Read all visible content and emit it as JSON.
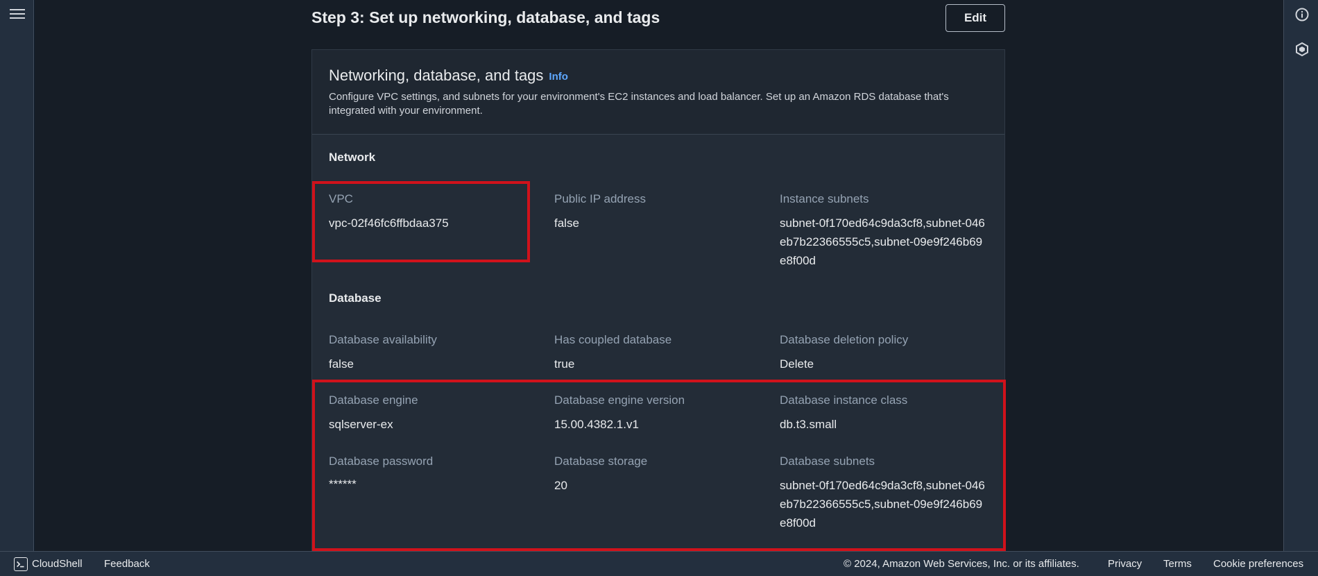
{
  "step": {
    "title": "Step 3: Set up networking, database, and tags",
    "edit_label": "Edit"
  },
  "panel": {
    "title": "Networking, database, and tags",
    "info_label": "Info",
    "description": "Configure VPC settings, and subnets for your environment's EC2 instances and load balancer. Set up an Amazon RDS database that's integrated with your environment."
  },
  "network": {
    "heading": "Network",
    "vpc_label": "VPC",
    "vpc_value": "vpc-02f46fc6ffbdaa375",
    "public_ip_label": "Public IP address",
    "public_ip_value": "false",
    "instance_subnets_label": "Instance subnets",
    "instance_subnets_value": "subnet-0f170ed64c9da3cf8,subnet-046eb7b22366555c5,subnet-09e9f246b69e8f00d"
  },
  "database": {
    "heading": "Database",
    "availability_label": "Database availability",
    "availability_value": "false",
    "coupled_label": "Has coupled database",
    "coupled_value": "true",
    "deletion_label": "Database deletion policy",
    "deletion_value": "Delete",
    "engine_label": "Database engine",
    "engine_value": "sqlserver-ex",
    "engine_version_label": "Database engine version",
    "engine_version_value": "15.00.4382.1.v1",
    "instance_class_label": "Database instance class",
    "instance_class_value": "db.t3.small",
    "password_label": "Database password",
    "password_value": "******",
    "storage_label": "Database storage",
    "storage_value": "20",
    "subnets_label": "Database subnets",
    "subnets_value": "subnet-0f170ed64c9da3cf8,subnet-046eb7b22366555c5,subnet-09e9f246b69e8f00d"
  },
  "footer": {
    "cloudshell": "CloudShell",
    "feedback": "Feedback",
    "copyright": "© 2024, Amazon Web Services, Inc. or its affiliates.",
    "privacy": "Privacy",
    "terms": "Terms",
    "cookies": "Cookie preferences"
  },
  "icons": {
    "menu": "hamburger-menu-icon",
    "info": "info-circle-icon",
    "settings": "hexagon-settings-icon",
    "cloudshell": "terminal-icon"
  },
  "colors": {
    "highlight": "#d0121b",
    "link": "#5ea8ff"
  }
}
